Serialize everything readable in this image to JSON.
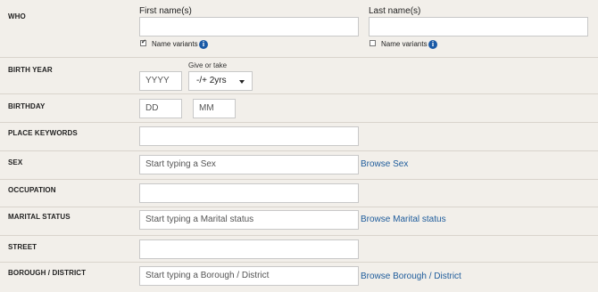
{
  "who": {
    "label": "WHO",
    "first_name_header": "First name(s)",
    "first_name_value": "",
    "last_name_header": "Last name(s)",
    "last_name_value": "",
    "first_variants_label": "Name variants",
    "first_variants_checked": true,
    "last_variants_label": "Name variants",
    "last_variants_checked": false,
    "info_icon": "i"
  },
  "birth_year": {
    "label": "BIRTH YEAR",
    "placeholder": "YYYY",
    "give_or_take_label": "Give or take",
    "range_value": "-/+ 2yrs"
  },
  "birthday": {
    "label": "BIRTHDAY",
    "day_placeholder": "DD",
    "month_placeholder": "MM"
  },
  "place_keywords": {
    "label": "PLACE KEYWORDS",
    "value": ""
  },
  "sex": {
    "label": "SEX",
    "placeholder": "Start typing a Sex",
    "browse_label": "Browse Sex"
  },
  "occupation": {
    "label": "OCCUPATION",
    "value": ""
  },
  "marital_status": {
    "label": "MARITAL STATUS",
    "placeholder": "Start typing a Marital status",
    "browse_label": "Browse Marital status"
  },
  "street": {
    "label": "STREET",
    "value": ""
  },
  "borough": {
    "label": "BOROUGH / DISTRICT",
    "placeholder": "Start typing a Borough / District",
    "browse_label": "Browse Borough / District"
  },
  "colors": {
    "link": "#1d5b9b",
    "background": "#f2efea",
    "info": "#1b5aa6"
  }
}
